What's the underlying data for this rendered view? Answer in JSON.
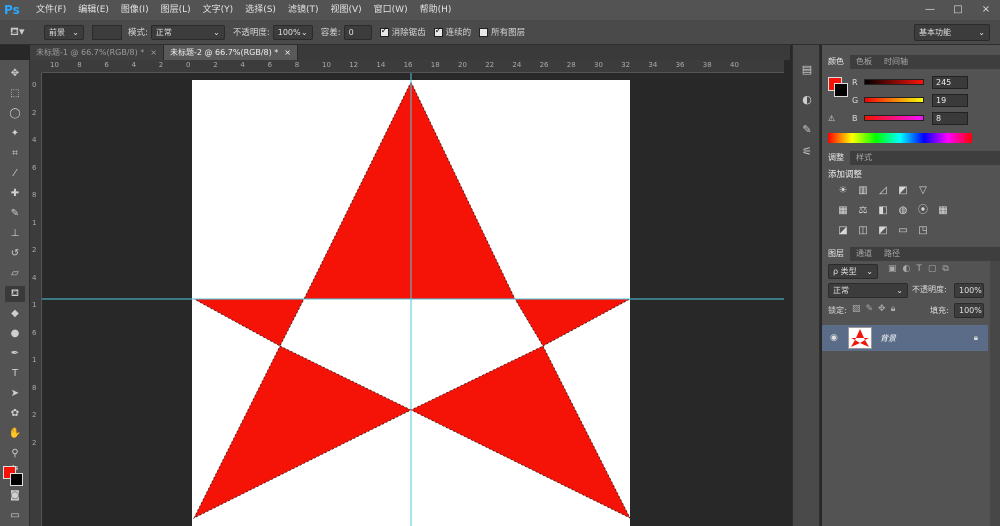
{
  "app": {
    "logo": "Ps"
  },
  "menu": [
    "文件(F)",
    "编辑(E)",
    "图像(I)",
    "图层(L)",
    "文字(Y)",
    "选择(S)",
    "滤镜(T)",
    "视图(V)",
    "窗口(W)",
    "帮助(H)"
  ],
  "window_controls": [
    "—",
    "□",
    "×"
  ],
  "options": {
    "fill_source": "前景",
    "mode_label": "模式:",
    "mode_value": "正常",
    "opacity_label": "不透明度:",
    "opacity_value": "100%",
    "tolerance_label": "容差:",
    "tolerance_value": "0",
    "antialias_label": "消除锯齿",
    "antialias_checked": true,
    "contiguous_label": "连续的",
    "contiguous_checked": true,
    "all_layers_label": "所有图层",
    "all_layers_checked": false,
    "workspace": "基本功能"
  },
  "tabs": [
    {
      "label": "未标题-1 @ 66.7%(RGB/8) *",
      "active": false,
      "close": "×"
    },
    {
      "label": "未标题-2 @ 66.7%(RGB/8) *",
      "active": true,
      "close": "×"
    }
  ],
  "ruler_h": [
    "10",
    "8",
    "6",
    "4",
    "2",
    "0",
    "2",
    "4",
    "6",
    "8",
    "10",
    "12",
    "14",
    "16",
    "18",
    "20",
    "22",
    "24",
    "26",
    "28",
    "30",
    "32",
    "34",
    "36",
    "38",
    "40"
  ],
  "ruler_v": [
    "0",
    "2",
    "4",
    "6",
    "8",
    "1",
    "2",
    "4",
    "1",
    "6",
    "1",
    "8",
    "2",
    "2"
  ],
  "colors": {
    "star_red": "#f51308",
    "canvas_bg": "#ffffff",
    "pasteboard": "#282828",
    "guide": "#4fc6e0",
    "foreground": "#f51308",
    "background": "#000000"
  },
  "color_panel": {
    "tabs": [
      "颜色",
      "色板",
      "时间轴"
    ],
    "channels": [
      {
        "label": "R",
        "value": "245"
      },
      {
        "label": "G",
        "value": "19"
      },
      {
        "label": "B",
        "value": "8"
      }
    ]
  },
  "adjust_panel": {
    "tabs": [
      "调整",
      "样式"
    ],
    "title": "添加调整",
    "icons": [
      "brightness-icon",
      "levels-icon",
      "curves-icon",
      "exposure-icon",
      "vibrance-icon",
      "hue-icon",
      "balance-icon",
      "bw-icon",
      "photo-filter-icon",
      "mixer-icon",
      "lookup-icon",
      "invert-icon",
      "posterize-icon",
      "threshold-icon",
      "gradient-map-icon",
      "selective-color-icon"
    ]
  },
  "layers_panel": {
    "tabs": [
      "图层",
      "通道",
      "路径"
    ],
    "filter_label": "ρ 类型",
    "blend_mode": "正常",
    "opacity_label": "不透明度:",
    "opacity_value": "100%",
    "lock_label": "锁定:",
    "fill_label": "填充:",
    "fill_value": "100%",
    "layer_name": "背景"
  }
}
